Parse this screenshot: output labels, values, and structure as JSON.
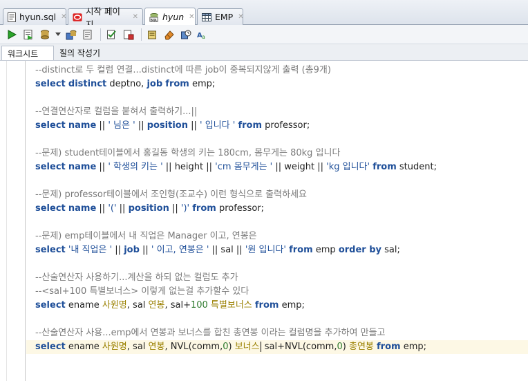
{
  "tabs": [
    {
      "label": "hyun.sql",
      "icon": "sql-file-icon",
      "italic": false,
      "active": false
    },
    {
      "label": "시작 페이지",
      "icon": "oracle-start-icon",
      "italic": false,
      "active": false
    },
    {
      "label": "hyun",
      "icon": "sql-worksheet-icon",
      "italic": true,
      "active": true
    },
    {
      "label": "EMP",
      "icon": "table-grid-icon",
      "italic": false,
      "active": false
    }
  ],
  "toolbar": {
    "icons": [
      "run-statement-icon",
      "run-script-icon",
      "commit-icon",
      "rollback-icon",
      "explain-plan-icon",
      "autotrace-icon",
      "sql-tuning-icon",
      "clear-icon",
      "history-icon",
      "format-icon"
    ]
  },
  "subtabs": {
    "worksheet_label": "워크시트",
    "query_builder_label": "질의 작성기"
  },
  "editor": {
    "lines": [
      [
        [
          "cm",
          "--distinct로 두 컬럼 연결...distinct에 따른 job이 중복되지않게 출력 (총9개)"
        ]
      ],
      [
        [
          "kw",
          "select"
        ],
        [
          "t",
          " "
        ],
        [
          "kw",
          "distinct"
        ],
        [
          "t",
          " deptno, "
        ],
        [
          "kw",
          "job"
        ],
        [
          "t",
          " "
        ],
        [
          "kw",
          "from"
        ],
        [
          "t",
          " emp;"
        ]
      ],
      [],
      [
        [
          "cm",
          "--연결연산자로 컬럼을 붙혀서 출력하기...||"
        ]
      ],
      [
        [
          "kw",
          "select"
        ],
        [
          "t",
          " "
        ],
        [
          "kw",
          "name"
        ],
        [
          "t",
          " || "
        ],
        [
          "str",
          "' 님은 '"
        ],
        [
          "t",
          " || "
        ],
        [
          "kw",
          "position"
        ],
        [
          "t",
          " || "
        ],
        [
          "str",
          "' 입니다 '"
        ],
        [
          "t",
          " "
        ],
        [
          "kw",
          "from"
        ],
        [
          "t",
          " professor;"
        ]
      ],
      [],
      [
        [
          "cm",
          "--문제) student테이블에서 홍길동 학생의 키는 180cm, 몸무게는 80kg 입니다"
        ]
      ],
      [
        [
          "kw",
          "select"
        ],
        [
          "t",
          " "
        ],
        [
          "kw",
          "name"
        ],
        [
          "t",
          " || "
        ],
        [
          "str",
          "' 학생의 키는 '"
        ],
        [
          "t",
          " || height || "
        ],
        [
          "str",
          "'cm 몸무게는 '"
        ],
        [
          "t",
          " || weight || "
        ],
        [
          "str",
          "'kg 입니다'"
        ],
        [
          "t",
          " "
        ],
        [
          "kw",
          "from"
        ],
        [
          "t",
          " student;"
        ]
      ],
      [],
      [
        [
          "cm",
          "--문제) professor테이블에서 조인형(조교수) 이런 형식으로 출력하세요"
        ]
      ],
      [
        [
          "kw",
          "select"
        ],
        [
          "t",
          " "
        ],
        [
          "kw",
          "name"
        ],
        [
          "t",
          " || "
        ],
        [
          "str",
          "'('"
        ],
        [
          "t",
          " || "
        ],
        [
          "kw",
          "position"
        ],
        [
          "t",
          " || "
        ],
        [
          "str",
          "')'"
        ],
        [
          "t",
          " "
        ],
        [
          "kw",
          "from"
        ],
        [
          "t",
          " professor;"
        ]
      ],
      [],
      [
        [
          "cm",
          "--문제) emp테이블에서 내 직업은 Manager 이고, 연봉은"
        ]
      ],
      [
        [
          "kw",
          "select"
        ],
        [
          "t",
          " "
        ],
        [
          "str",
          "'내 직업은 '"
        ],
        [
          "t",
          " || "
        ],
        [
          "kw",
          "job"
        ],
        [
          "t",
          " || "
        ],
        [
          "str",
          "' 이고, 연봉은 '"
        ],
        [
          "t",
          " || sal || "
        ],
        [
          "str",
          "'원 입니다'"
        ],
        [
          "t",
          " "
        ],
        [
          "kw",
          "from"
        ],
        [
          "t",
          " emp "
        ],
        [
          "kw",
          "order by"
        ],
        [
          "t",
          " sal;"
        ]
      ],
      [],
      [
        [
          "cm",
          "--산술연산자 사용하기...계산을 하되 없는 컬럼도 추가"
        ]
      ],
      [
        [
          "cm",
          "--<sal+100 특별보너스> 이렇게 없는걸 추가할수 있다"
        ]
      ],
      [
        [
          "kw",
          "select"
        ],
        [
          "t",
          " ename "
        ],
        [
          "alias",
          "사원명"
        ],
        [
          "t",
          ", sal "
        ],
        [
          "alias",
          "연봉"
        ],
        [
          "t",
          ", sal+"
        ],
        [
          "num",
          "100"
        ],
        [
          "t",
          " "
        ],
        [
          "alias",
          "특별보너스"
        ],
        [
          "t",
          " "
        ],
        [
          "kw",
          "from"
        ],
        [
          "t",
          " emp;"
        ]
      ],
      [],
      [
        [
          "cm",
          "--산술연산자 사용...emp에서 연봉과 보너스를 합친 총연봉 이라는 컬럼명을 추가하여 만들고"
        ]
      ],
      [
        [
          "kw",
          "select"
        ],
        [
          "t",
          " ename "
        ],
        [
          "alias",
          "사원명"
        ],
        [
          "t",
          ", sal "
        ],
        [
          "alias",
          "연봉"
        ],
        [
          "t",
          ", NVL(comm,"
        ],
        [
          "num",
          "0"
        ],
        [
          "t",
          ") "
        ],
        [
          "alias",
          "보너스"
        ],
        [
          "caret",
          ""
        ],
        [
          "t",
          " sal+NVL(comm,"
        ],
        [
          "num",
          "0"
        ],
        [
          "t",
          ") "
        ],
        [
          "alias",
          "총연봉"
        ],
        [
          "t",
          " "
        ],
        [
          "kw",
          "from"
        ],
        [
          "t",
          " emp;"
        ]
      ]
    ],
    "current_line_index": 20
  }
}
